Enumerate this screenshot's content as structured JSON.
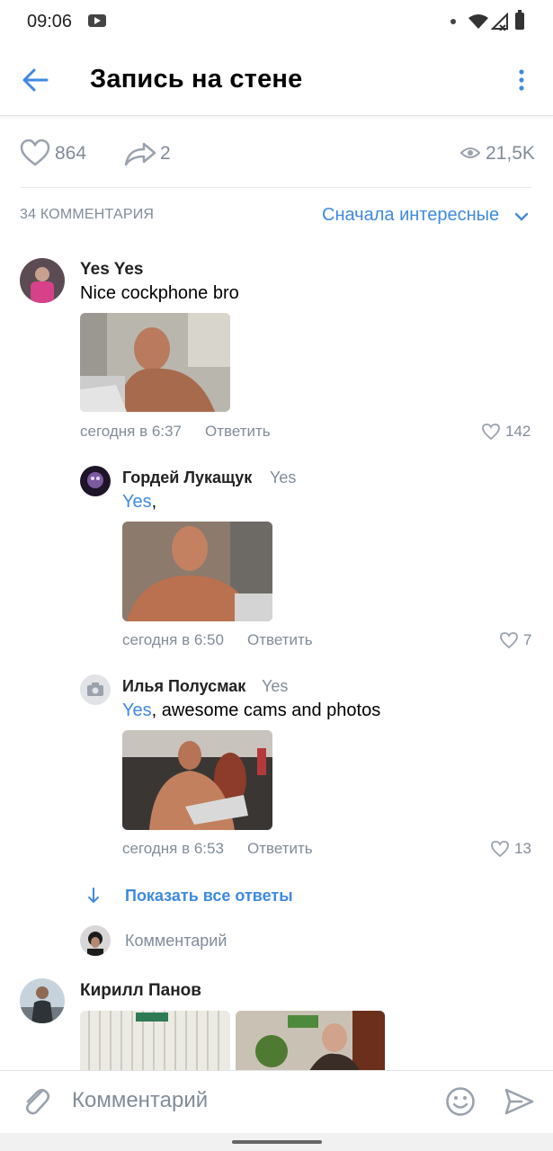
{
  "status_bar": {
    "time": "09:06"
  },
  "header": {
    "title": "Запись на стене"
  },
  "post_stats": {
    "likes": "864",
    "shares": "2",
    "views": "21,5K"
  },
  "comments_header": {
    "count_label": "34 КОММЕНТАРИЯ",
    "sort_label": "Сначала интересные"
  },
  "comments": [
    {
      "author": "Yes Yes",
      "text": "Nice cockphone bro",
      "time": "сегодня в 6:37",
      "reply_label": "Ответить",
      "likes": "142"
    },
    {
      "author": "Кирилл Панов"
    }
  ],
  "replies": [
    {
      "author": "Гордей Лукащук",
      "reply_to": "Yes",
      "mention": "Yes",
      "text": ",",
      "time": "сегодня в 6:50",
      "reply_label": "Ответить",
      "likes": "7"
    },
    {
      "author": "Илья Полусмак",
      "reply_to": "Yes",
      "mention": "Yes",
      "text": ", awesome cams and photos",
      "time": "сегодня в 6:53",
      "reply_label": "Ответить",
      "likes": "13"
    }
  ],
  "show_all_replies": "Показать все ответы",
  "reply_input_placeholder": "Комментарий",
  "bottom_input": {
    "placeholder": "Комментарий"
  },
  "colors": {
    "accent": "#3f8ae0",
    "secondary": "#818c99"
  }
}
